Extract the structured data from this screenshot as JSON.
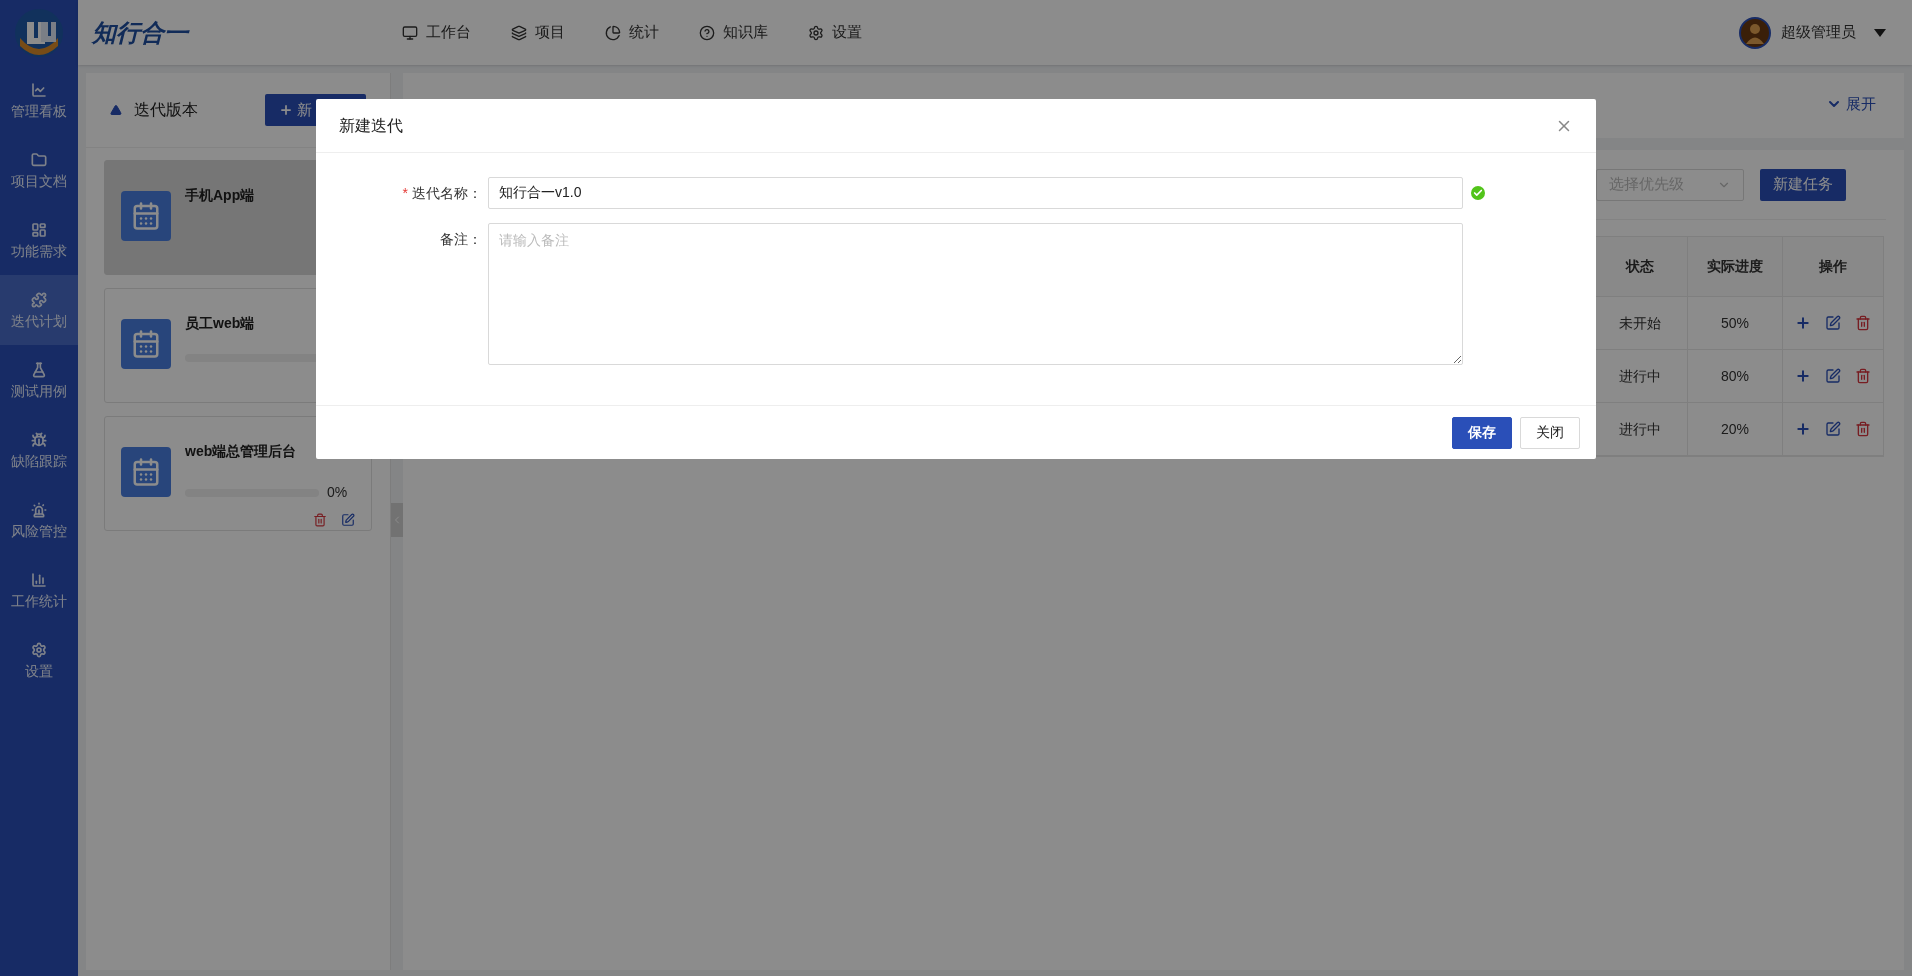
{
  "brand": {
    "name": "知行合一"
  },
  "top_nav": [
    {
      "label": "工作台",
      "kind": "monitor"
    },
    {
      "label": "项目",
      "kind": "layers"
    },
    {
      "label": "统计",
      "kind": "pie"
    },
    {
      "label": "知识库",
      "kind": "help"
    },
    {
      "label": "设置",
      "kind": "gear"
    }
  ],
  "user": {
    "name": "超级管理员"
  },
  "sidebar": {
    "items": [
      {
        "label": "管理看板",
        "kind": "chart",
        "selected": false
      },
      {
        "label": "项目文档",
        "kind": "folder",
        "selected": false
      },
      {
        "label": "功能需求",
        "kind": "layout",
        "selected": false
      },
      {
        "label": "迭代计划",
        "kind": "puzzle",
        "selected": true
      },
      {
        "label": "测试用例",
        "kind": "flask",
        "selected": false
      },
      {
        "label": "缺陷跟踪",
        "kind": "bug",
        "selected": false
      },
      {
        "label": "风险管控",
        "kind": "siren",
        "selected": false
      },
      {
        "label": "工作统计",
        "kind": "bars",
        "selected": false
      },
      {
        "label": "设置",
        "kind": "gear",
        "selected": false
      }
    ]
  },
  "iterations_panel": {
    "title": "迭代版本",
    "new_button": "新",
    "items": [
      {
        "name": "手机App端",
        "selected": true
      },
      {
        "name": "员工web端",
        "selected": false,
        "level": 0
      },
      {
        "name": "web端总管理后台",
        "selected": false,
        "level": 0,
        "percent": "0%",
        "actions": [
          {
            "kind": "delete"
          },
          {
            "kind": "edit"
          }
        ]
      }
    ]
  },
  "tasks_panel": {
    "expand_link": "展开",
    "priority_select": {
      "placeholder": "选择优先级"
    },
    "new_task_button": "新建任务",
    "table": {
      "columns": [
        "状态",
        "实际进度",
        "操作"
      ],
      "rows": [
        {
          "status": "未开始",
          "progress": "50%"
        },
        {
          "status": "进行中",
          "progress": "80%"
        },
        {
          "status": "进行中",
          "progress": "20%"
        }
      ]
    }
  },
  "dialog": {
    "title": "新建迭代",
    "fields": [
      {
        "kind": "text",
        "label": "迭代名称：",
        "required_mark": "*",
        "value": "知行合一v1.0",
        "valid": true
      },
      {
        "kind": "textarea",
        "label": "备注：",
        "placeholder": "请输入备注"
      }
    ],
    "buttons": [
      {
        "label": "保存",
        "primary": true
      },
      {
        "label": "关闭",
        "primary": false
      }
    ]
  }
}
